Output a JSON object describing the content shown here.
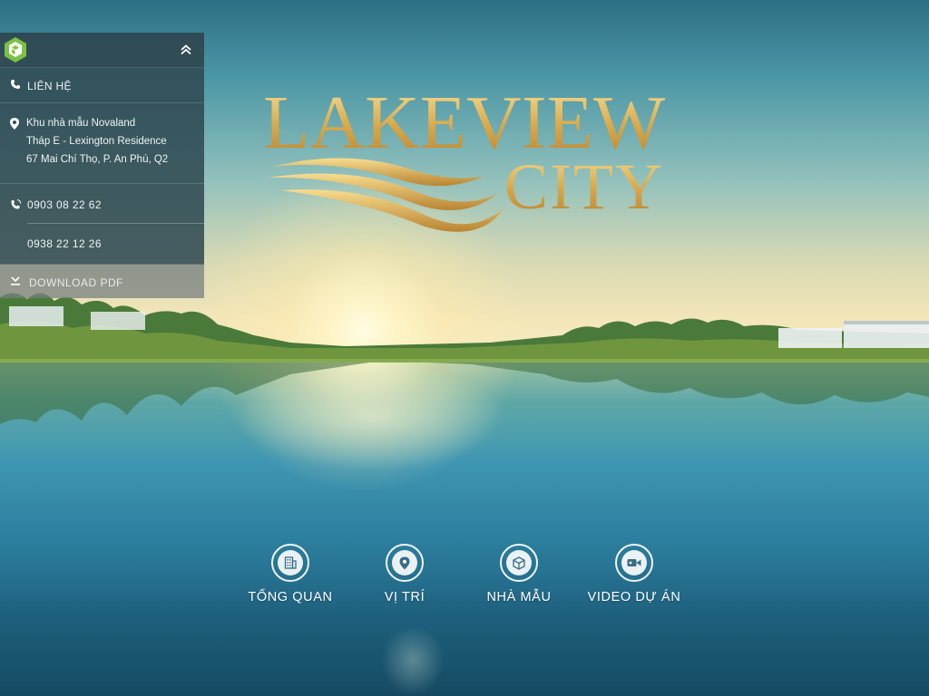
{
  "logo": {
    "line1": "LAKEVIEW",
    "line2": "CITY",
    "gold_color": "#d6a64b"
  },
  "panel": {
    "brand_icon": "novaland-cube-icon",
    "collapse_icon": "double-chevron-up-icon",
    "contact": {
      "icon": "phone-icon",
      "label": "LIÊN HỆ"
    },
    "address": {
      "icon": "location-pin-icon",
      "lines": [
        "Khu nhà mẫu Novaland",
        "Tháp E - Lexington Residence",
        "67 Mai Chí Thọ, P. An Phú, Q2"
      ]
    },
    "phones": {
      "icon": "phone-ring-icon",
      "numbers": [
        "0903 08 22 62",
        "0938 22 12 26"
      ]
    },
    "download": {
      "icon": "download-icon",
      "label": "DOWNLOAD PDF"
    },
    "accent": "#7cc242"
  },
  "nav": [
    {
      "icon": "building-icon",
      "label": "TỔNG QUAN"
    },
    {
      "icon": "map-pin-icon",
      "label": "VỊ TRÍ"
    },
    {
      "icon": "cube-icon",
      "label": "NHÀ MẪU"
    },
    {
      "icon": "video-camera-icon",
      "label": "VIDEO DỰ ÁN"
    }
  ]
}
